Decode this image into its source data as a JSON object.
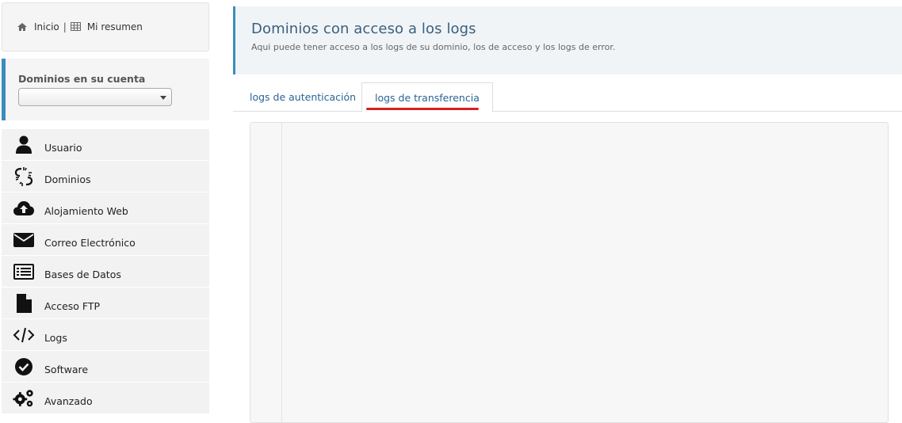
{
  "breadcrumb": {
    "home_icon": "home-icon",
    "home_label": "Inicio",
    "separator": "|",
    "summary_icon": "table-icon",
    "summary_label": "Mi resumen"
  },
  "domains": {
    "title": "Dominios en su cuenta",
    "selected": ""
  },
  "menu": {
    "items": [
      {
        "label": "Usuario",
        "icon": "user-icon"
      },
      {
        "label": "Dominios",
        "icon": "broken-link-icon"
      },
      {
        "label": "Alojamiento Web",
        "icon": "cloud-upload-icon"
      },
      {
        "label": "Correo Electrónico",
        "icon": "envelope-icon"
      },
      {
        "label": "Bases de Datos",
        "icon": "list-box-icon"
      },
      {
        "label": "Acceso FTP",
        "icon": "file-icon"
      },
      {
        "label": "Logs",
        "icon": "code-icon"
      },
      {
        "label": "Software",
        "icon": "check-circle-icon"
      },
      {
        "label": "Avanzado",
        "icon": "gears-icon"
      }
    ]
  },
  "page": {
    "title": "Dominios con acceso a los logs",
    "subtitle": "Aqui puede tener acceso a los logs de su dominio, los de acceso y los logs de error."
  },
  "tabs": [
    {
      "label": "logs de autenticación",
      "active": false
    },
    {
      "label": "logs de transferencia",
      "active": true
    }
  ],
  "colors": {
    "accent": "#3c8dbc",
    "tab_text": "#2a6496",
    "underline": "#d92020"
  }
}
